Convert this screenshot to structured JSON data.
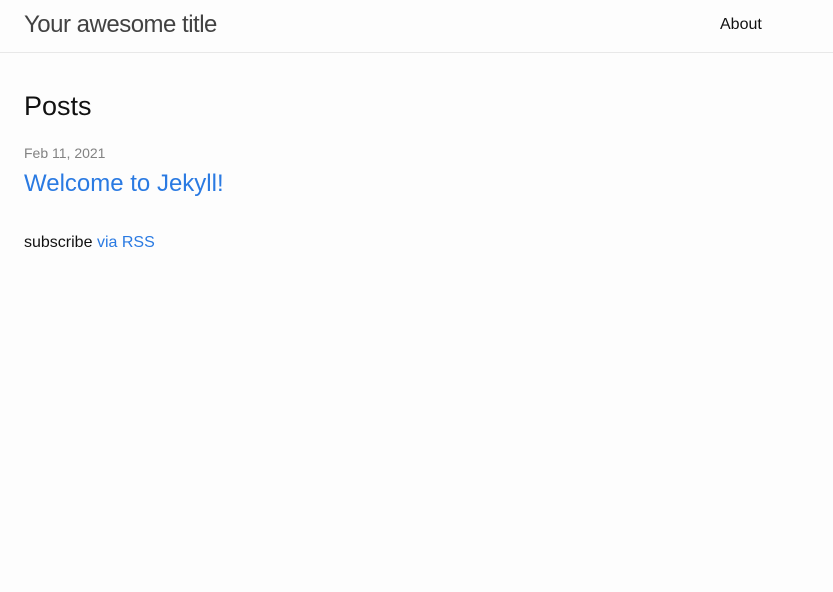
{
  "header": {
    "site_title": "Your awesome title",
    "nav": [
      {
        "label": "About"
      }
    ]
  },
  "main": {
    "heading": "Posts",
    "posts": [
      {
        "date": "Feb 11, 2021",
        "title": "Welcome to Jekyll!"
      }
    ],
    "rss": {
      "prefix": "subscribe",
      "link_label": "via RSS"
    }
  },
  "colors": {
    "background": "#fdfdfd",
    "text": "#111111",
    "link": "#2a7ae2",
    "meta": "#828282",
    "title": "#424242"
  }
}
